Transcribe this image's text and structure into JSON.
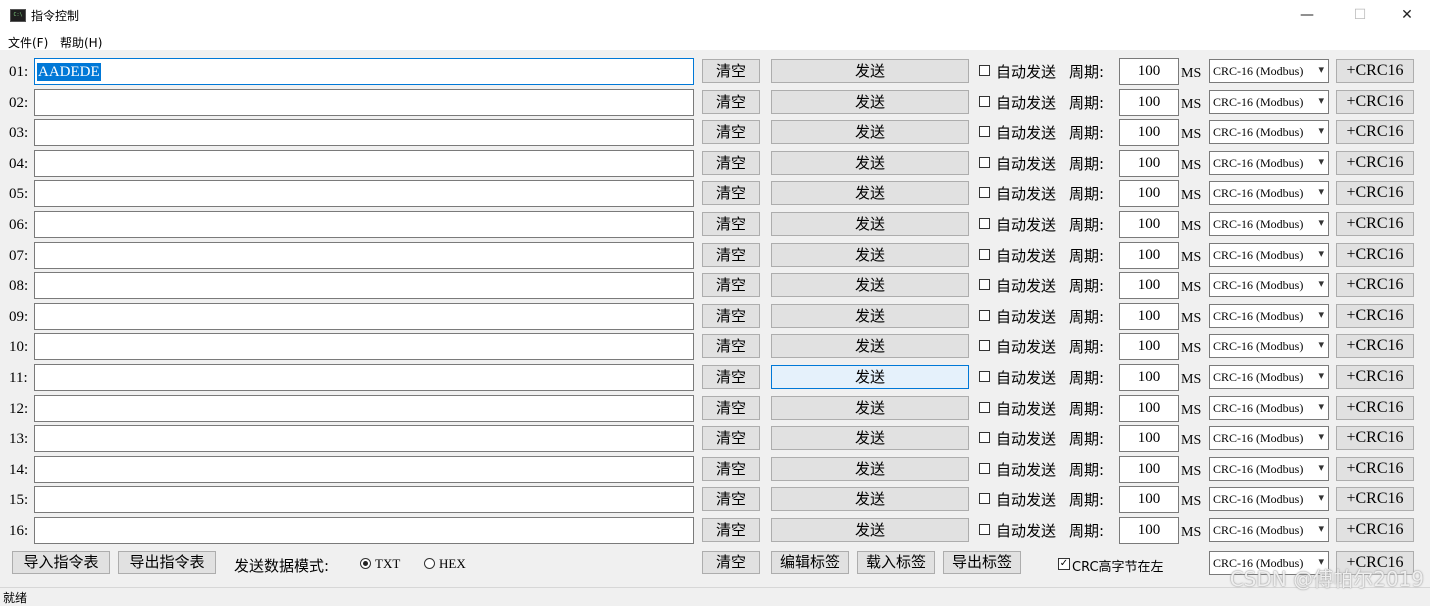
{
  "window": {
    "title": "指令控制",
    "icon_label": "C:\\",
    "minimize_glyph": "—",
    "maximize_glyph": "☐",
    "close_glyph": "✕"
  },
  "menu": [
    "文件(F)",
    "帮助(H)"
  ],
  "rows": [
    {
      "num": "01:",
      "value": "AADEDE",
      "clear": "清空",
      "send": "发送",
      "auto": "自动发送",
      "period_label": "周期:",
      "period": "100",
      "unit": "MS",
      "crc": "CRC-16 (Modbus)",
      "crc_add": "+CRC16"
    },
    {
      "num": "02:",
      "value": "",
      "clear": "清空",
      "send": "发送",
      "auto": "自动发送",
      "period_label": "周期:",
      "period": "100",
      "unit": "MS",
      "crc": "CRC-16 (Modbus)",
      "crc_add": "+CRC16"
    },
    {
      "num": "03:",
      "value": "",
      "clear": "清空",
      "send": "发送",
      "auto": "自动发送",
      "period_label": "周期:",
      "period": "100",
      "unit": "MS",
      "crc": "CRC-16 (Modbus)",
      "crc_add": "+CRC16"
    },
    {
      "num": "04:",
      "value": "",
      "clear": "清空",
      "send": "发送",
      "auto": "自动发送",
      "period_label": "周期:",
      "period": "100",
      "unit": "MS",
      "crc": "CRC-16 (Modbus)",
      "crc_add": "+CRC16"
    },
    {
      "num": "05:",
      "value": "",
      "clear": "清空",
      "send": "发送",
      "auto": "自动发送",
      "period_label": "周期:",
      "period": "100",
      "unit": "MS",
      "crc": "CRC-16 (Modbus)",
      "crc_add": "+CRC16"
    },
    {
      "num": "06:",
      "value": "",
      "clear": "清空",
      "send": "发送",
      "auto": "自动发送",
      "period_label": "周期:",
      "period": "100",
      "unit": "MS",
      "crc": "CRC-16 (Modbus)",
      "crc_add": "+CRC16"
    },
    {
      "num": "07:",
      "value": "",
      "clear": "清空",
      "send": "发送",
      "auto": "自动发送",
      "period_label": "周期:",
      "period": "100",
      "unit": "MS",
      "crc": "CRC-16 (Modbus)",
      "crc_add": "+CRC16"
    },
    {
      "num": "08:",
      "value": "",
      "clear": "清空",
      "send": "发送",
      "auto": "自动发送",
      "period_label": "周期:",
      "period": "100",
      "unit": "MS",
      "crc": "CRC-16 (Modbus)",
      "crc_add": "+CRC16"
    },
    {
      "num": "09:",
      "value": "",
      "clear": "清空",
      "send": "发送",
      "auto": "自动发送",
      "period_label": "周期:",
      "period": "100",
      "unit": "MS",
      "crc": "CRC-16 (Modbus)",
      "crc_add": "+CRC16"
    },
    {
      "num": "10:",
      "value": "",
      "clear": "清空",
      "send": "发送",
      "auto": "自动发送",
      "period_label": "周期:",
      "period": "100",
      "unit": "MS",
      "crc": "CRC-16 (Modbus)",
      "crc_add": "+CRC16"
    },
    {
      "num": "11:",
      "value": "",
      "clear": "清空",
      "send": "发送",
      "auto": "自动发送",
      "period_label": "周期:",
      "period": "100",
      "unit": "MS",
      "crc": "CRC-16 (Modbus)",
      "crc_add": "+CRC16"
    },
    {
      "num": "12:",
      "value": "",
      "clear": "清空",
      "send": "发送",
      "auto": "自动发送",
      "period_label": "周期:",
      "period": "100",
      "unit": "MS",
      "crc": "CRC-16 (Modbus)",
      "crc_add": "+CRC16"
    },
    {
      "num": "13:",
      "value": "",
      "clear": "清空",
      "send": "发送",
      "auto": "自动发送",
      "period_label": "周期:",
      "period": "100",
      "unit": "MS",
      "crc": "CRC-16 (Modbus)",
      "crc_add": "+CRC16"
    },
    {
      "num": "14:",
      "value": "",
      "clear": "清空",
      "send": "发送",
      "auto": "自动发送",
      "period_label": "周期:",
      "period": "100",
      "unit": "MS",
      "crc": "CRC-16 (Modbus)",
      "crc_add": "+CRC16"
    },
    {
      "num": "15:",
      "value": "",
      "clear": "清空",
      "send": "发送",
      "auto": "自动发送",
      "period_label": "周期:",
      "period": "100",
      "unit": "MS",
      "crc": "CRC-16 (Modbus)",
      "crc_add": "+CRC16"
    },
    {
      "num": "16:",
      "value": "",
      "clear": "清空",
      "send": "发送",
      "auto": "自动发送",
      "period_label": "周期:",
      "period": "100",
      "unit": "MS",
      "crc": "CRC-16 (Modbus)",
      "crc_add": "+CRC16"
    }
  ],
  "bottom": {
    "import_label": "导入指令表",
    "export_label": "导出指令表",
    "mode_label": "发送数据模式:",
    "mode_options": [
      "TXT",
      "HEX"
    ],
    "mode_selected": "TXT",
    "clear_label": "清空",
    "edit_tags_label": "编辑标签",
    "load_tags_label": "载入标签",
    "export_tags_label": "导出标签",
    "crc_high_first_label": "CRC高字节在左",
    "crc_high_first_checked": true,
    "crc": "CRC-16 (Modbus)",
    "crc_add": "+CRC16"
  },
  "status": "就绪",
  "watermark": "CSDN @傅帕尔2019",
  "colors": {
    "accent": "#0078d7",
    "button_bg": "#e1e1e1",
    "client_bg": "#f0f0f0"
  }
}
